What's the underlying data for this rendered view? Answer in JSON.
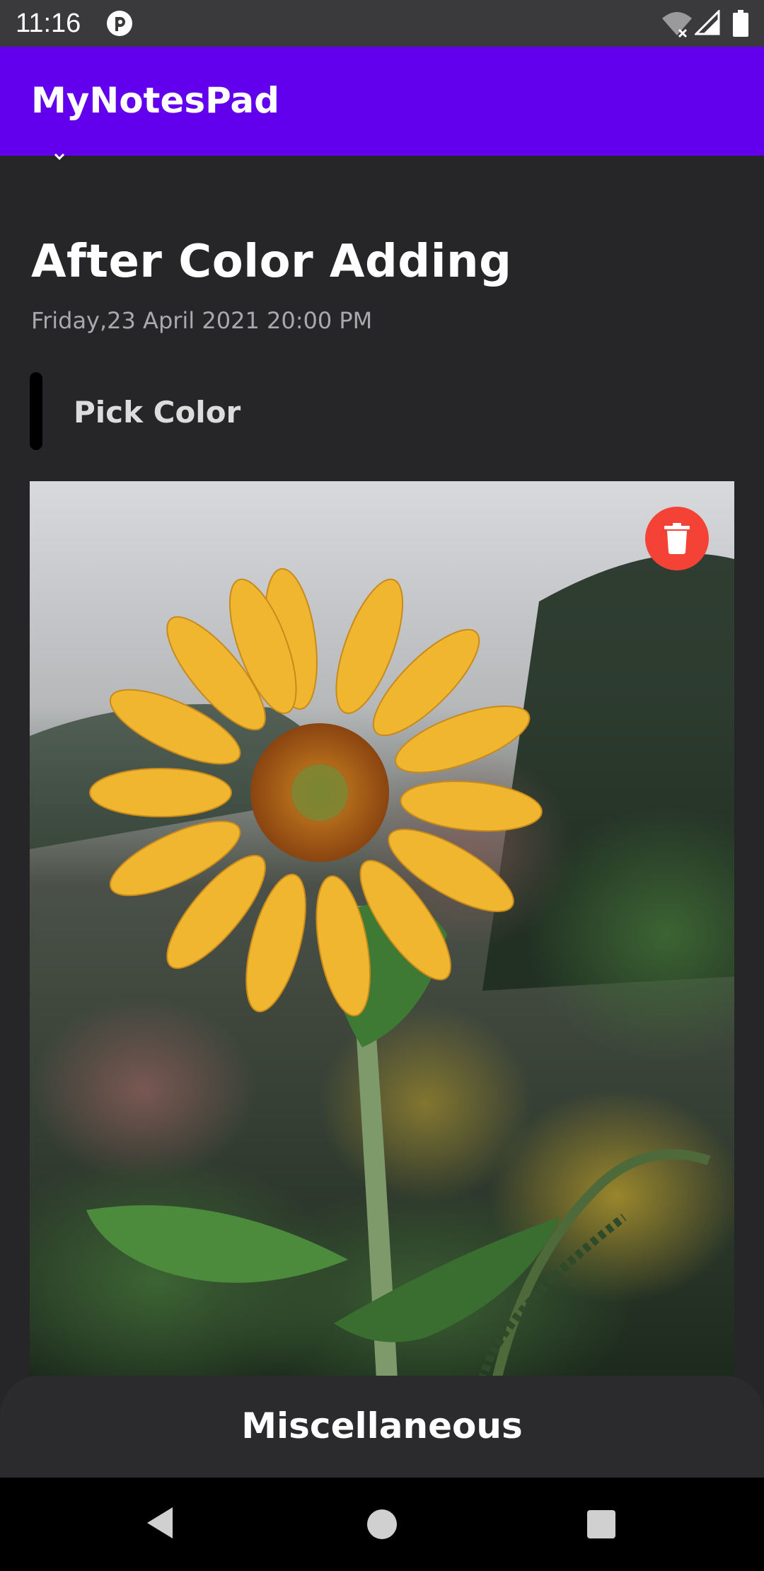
{
  "status_bar": {
    "time": "11:16",
    "icons": [
      "app-notification-icon",
      "wifi-off-icon",
      "cell-signal-icon",
      "battery-icon"
    ]
  },
  "app_bar": {
    "title": "MyNotesPad",
    "color": "#6200ee"
  },
  "note": {
    "title": "After Color Adding",
    "date": "Friday,23 April 2021 20:00 PM",
    "pick_color_label": "Pick Color",
    "selected_color": "#000000",
    "image_alt": "sunflower-photo"
  },
  "delete_button": {
    "icon": "trash-icon",
    "color": "#f44336"
  },
  "bottom_sheet": {
    "label": "Miscellaneous"
  },
  "nav_bar": {
    "icons": [
      "back-triangle-icon",
      "home-circle-icon",
      "recents-square-icon"
    ]
  }
}
